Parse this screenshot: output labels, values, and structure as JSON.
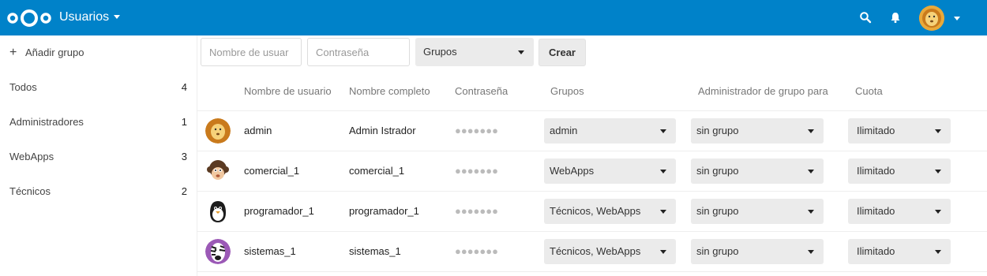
{
  "header": {
    "app_title": "Usuarios",
    "icons": [
      "nextcloud-logo",
      "search-icon",
      "bell-icon",
      "user-avatar",
      "caret-down-icon"
    ],
    "color": "#0082c9"
  },
  "sidebar": {
    "add_group_label": "Añadir grupo",
    "groups": [
      {
        "label": "Todos",
        "count": "4"
      },
      {
        "label": "Administradores",
        "count": "1"
      },
      {
        "label": "WebApps",
        "count": "3"
      },
      {
        "label": "Técnicos",
        "count": "2"
      }
    ]
  },
  "new_user_form": {
    "username_placeholder": "Nombre de usuar",
    "password_placeholder": "Contraseña",
    "groups_label": "Grupos",
    "create_label": "Crear"
  },
  "table": {
    "headers": {
      "username": "Nombre de usuario",
      "fullname": "Nombre completo",
      "password": "Contraseña",
      "groups": "Grupos",
      "subadmin": "Administrador de grupo para",
      "quota": "Cuota"
    },
    "rows": [
      {
        "avatar": "lion-avatar",
        "username": "admin",
        "fullname": "Admin Istrador",
        "password": "●●●●●●●",
        "groups": "admin",
        "subadmin": "sin grupo",
        "quota": "Ilimitado"
      },
      {
        "avatar": "monkey-avatar",
        "username": "comercial_1",
        "fullname": "comercial_1",
        "password": "●●●●●●●",
        "groups": "WebApps",
        "subadmin": "sin grupo",
        "quota": "Ilimitado"
      },
      {
        "avatar": "penguin-avatar",
        "username": "programador_1",
        "fullname": "programador_1",
        "password": "●●●●●●●",
        "groups": "Técnicos, WebApps",
        "subadmin": "sin grupo",
        "quota": "Ilimitado"
      },
      {
        "avatar": "zebra-avatar",
        "username": "sistemas_1",
        "fullname": "sistemas_1",
        "password": "●●●●●●●",
        "groups": "Técnicos, WebApps",
        "subadmin": "sin grupo",
        "quota": "Ilimitado"
      }
    ]
  }
}
